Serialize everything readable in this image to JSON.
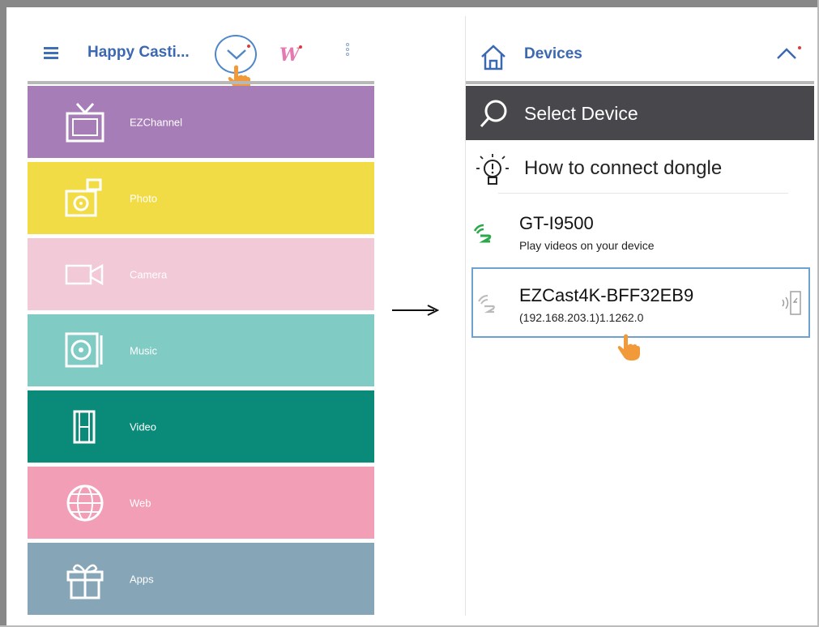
{
  "left_app": {
    "title": "Happy Casti...",
    "tiles": [
      {
        "label": "EZChannel",
        "icon": "tv-icon",
        "color": "#a77db8"
      },
      {
        "label": "Photo",
        "icon": "photo-icon",
        "color": "#f2dc45"
      },
      {
        "label": "Camera",
        "icon": "camera-icon",
        "color": "#f2c9d6"
      },
      {
        "label": "Music",
        "icon": "music-icon",
        "color": "#80cbc4"
      },
      {
        "label": "Video",
        "icon": "film-icon",
        "color": "#0a8a79"
      },
      {
        "label": "Web",
        "icon": "globe-icon",
        "color": "#f29eb7"
      },
      {
        "label": "Apps",
        "icon": "gift-icon",
        "color": "#86a6b8"
      }
    ]
  },
  "right_app": {
    "title": "Devices",
    "select_device": "Select Device",
    "how_to": "How to connect dongle",
    "devices": [
      {
        "name": "GT-I9500",
        "subtitle": "Play videos on your device",
        "icon": "ez-device-icon-active"
      },
      {
        "name": "EZCast4K-BFF32EB9",
        "subtitle": "(192.168.203.1)1.1262.0",
        "icon": "ez-device-icon-inactive",
        "selected": true
      }
    ]
  },
  "colors": {
    "accent_blue": "#3b68b1",
    "select_bar": "#48474c",
    "hand_orange": "#f29a3a",
    "logo_pink": "#e47ab0"
  }
}
